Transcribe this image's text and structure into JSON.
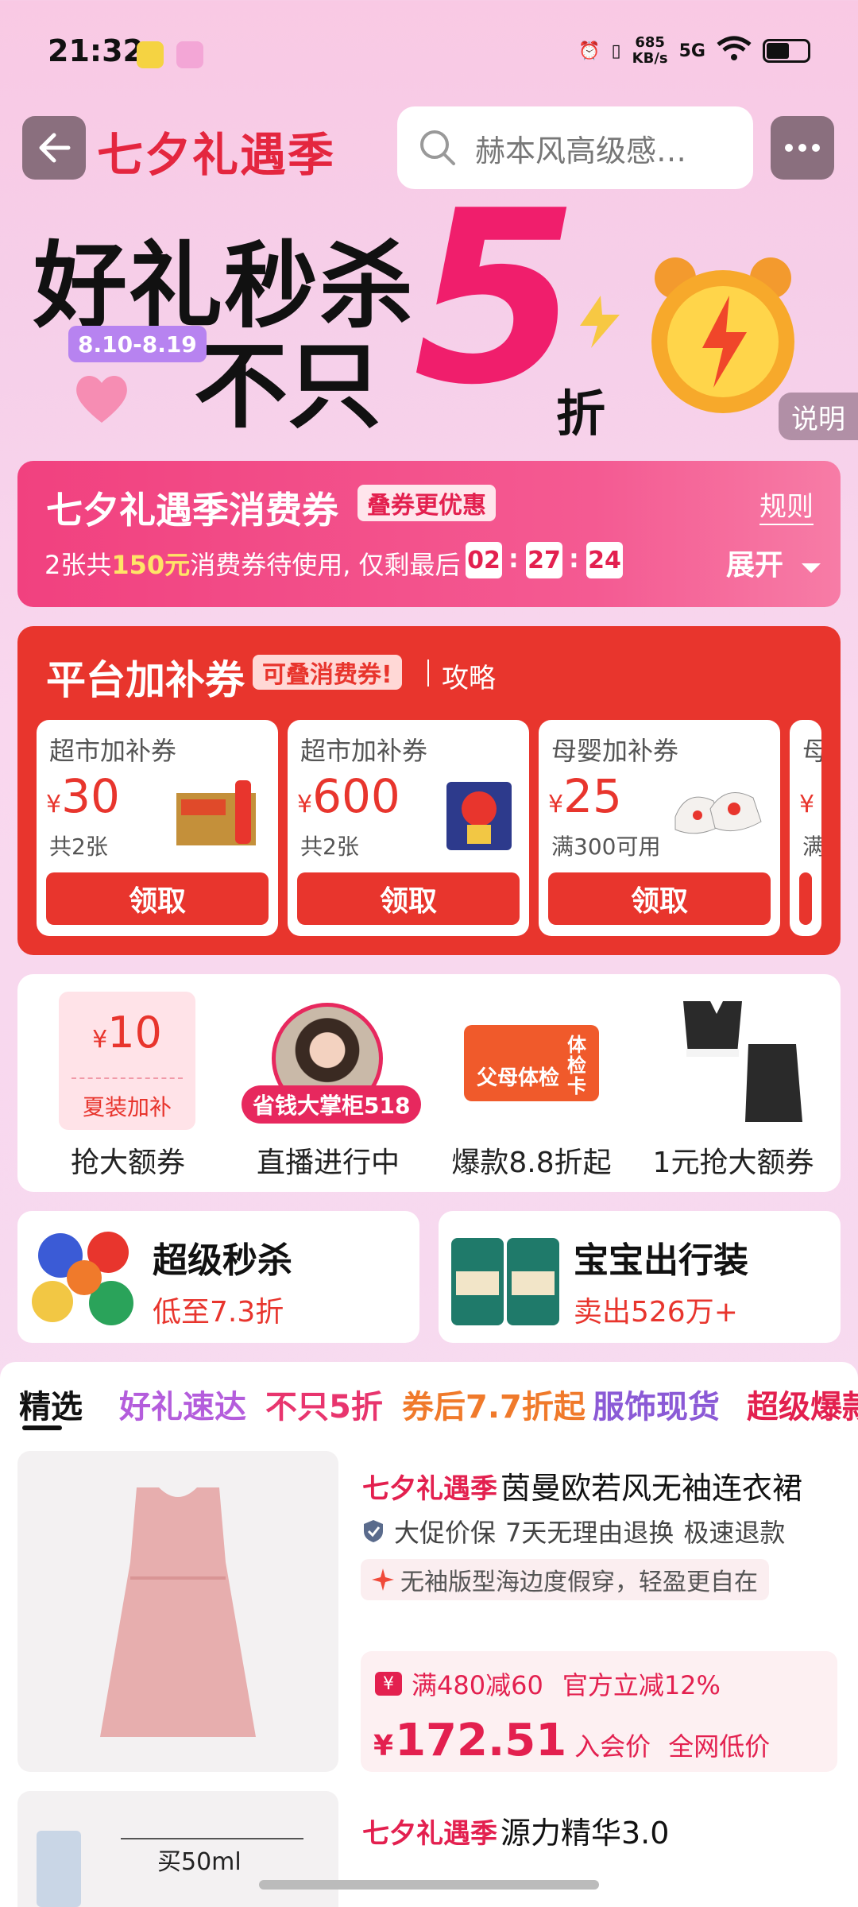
{
  "status_bar": {
    "time": "21:32",
    "net_speed": "685",
    "net_unit": "KB/s",
    "signal": "5G"
  },
  "header": {
    "title": "七夕礼遇季",
    "search_placeholder": "赫本风高级感…"
  },
  "hero": {
    "line1": "好礼秒杀",
    "line2": "不只",
    "big_number": "5",
    "suffix": "折",
    "date_range": "8.10-8.19",
    "explain": "说明"
  },
  "coupon_banner": {
    "title": "七夕礼遇季消费券",
    "tag": "叠券更优惠",
    "rule": "规则",
    "desc_prefix": "2张共",
    "desc_amount": "150元",
    "desc_suffix": "消费券待使用, 仅剩最后",
    "countdown": [
      "02",
      "27",
      "24"
    ],
    "expand": "展开"
  },
  "subsidy": {
    "title": "平台加补券",
    "tag": "可叠消费券!",
    "guide": "攻略",
    "items": [
      {
        "label": "超市加补券",
        "currency": "¥",
        "amount": "30",
        "note": "共2张",
        "button": "领取"
      },
      {
        "label": "超市加补券",
        "currency": "¥",
        "amount": "600",
        "note": "共2张",
        "button": "领取"
      },
      {
        "label": "母婴加补券",
        "currency": "¥",
        "amount": "25",
        "note": "满300可用",
        "button": "领取"
      }
    ],
    "partial_label": "母",
    "partial_currency": "¥",
    "partial_note": "满"
  },
  "activities": [
    {
      "label": "抢大额券",
      "coupon_currency": "¥",
      "coupon_amount": "10",
      "coupon_sub": "夏装加补"
    },
    {
      "label": "直播进行中",
      "badge": "省钱大掌柜518"
    },
    {
      "label": "爆款8.8折起",
      "card_text": "父母体检",
      "card_vertical": "体检卡"
    },
    {
      "label": "1元抢大额券"
    }
  ],
  "promos": [
    {
      "title": "超级秒杀",
      "sub": "低至7.3折"
    },
    {
      "title": "宝宝出行装",
      "sub": "卖出526万+"
    }
  ],
  "tabs": [
    "精选",
    "好礼速达",
    "不只5折",
    "券后7.7折起",
    "服饰现货",
    "超级爆款"
  ],
  "product1": {
    "brand": "七夕礼遇季",
    "name": "茵曼欧若风无袖连衣裙",
    "guarantees": [
      "大促价保",
      "7天无理由退换",
      "极速退款"
    ],
    "feature": "无袖版型海边度假穿，轻盈更自在",
    "deal_icon": "¥",
    "deal_text": "满480减60",
    "deal_extra": "官方立减12%",
    "currency": "¥",
    "price": "172.51",
    "price_label": "入会价",
    "price_note": "全网低价"
  },
  "product2": {
    "brand": "七夕礼遇季",
    "name": "源力精华3.0",
    "img_text": "买50ml"
  },
  "colors": {
    "accent": "#e3204f",
    "red": "#e8352d",
    "pink": "#f1417f"
  }
}
